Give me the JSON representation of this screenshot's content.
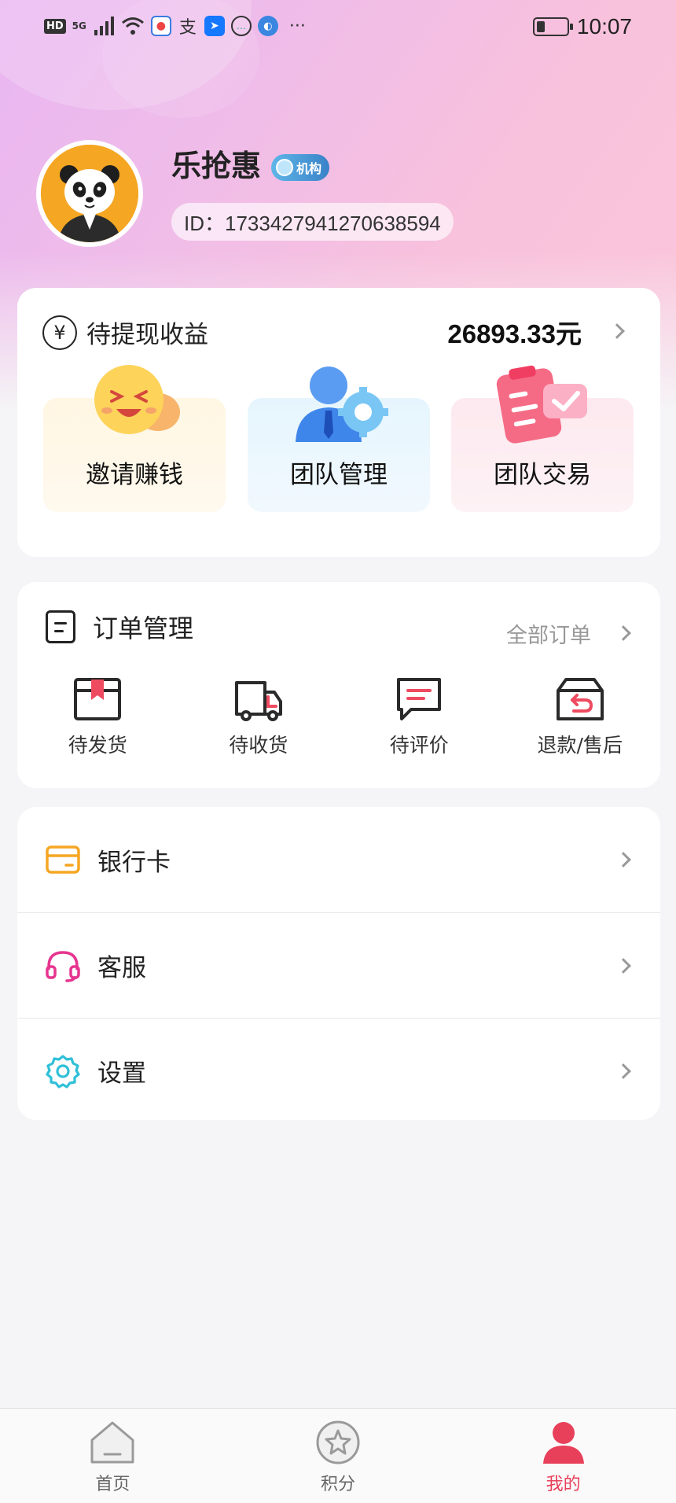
{
  "status_bar": {
    "hd": "HD",
    "network": "5G",
    "more": "···",
    "time": "10:07"
  },
  "profile": {
    "name": "乐抢惠",
    "badge": "机构",
    "id_text": "ID：1733427941270638594"
  },
  "earnings": {
    "currency_symbol": "¥",
    "title": "待提现收益",
    "amount": "26893.33元",
    "tiles": [
      {
        "label": "邀请赚钱",
        "icon": "emoji-laugh-icon"
      },
      {
        "label": "团队管理",
        "icon": "user-settings-icon"
      },
      {
        "label": "团队交易",
        "icon": "clipboard-check-icon"
      }
    ]
  },
  "orders": {
    "title": "订单管理",
    "all_link": "全部订单",
    "items": [
      {
        "label": "待发货",
        "icon": "package-icon"
      },
      {
        "label": "待收货",
        "icon": "truck-icon"
      },
      {
        "label": "待评价",
        "icon": "comment-icon"
      },
      {
        "label": "退款/售后",
        "icon": "return-box-icon"
      }
    ]
  },
  "menu": {
    "items": [
      {
        "label": "银行卡",
        "icon": "card-icon",
        "color": "#f5a623"
      },
      {
        "label": "客服",
        "icon": "headset-icon",
        "color": "#e6348f"
      },
      {
        "label": "设置",
        "icon": "gear-icon",
        "color": "#2fc0d8"
      }
    ]
  },
  "bottom_nav": {
    "items": [
      {
        "label": "首页",
        "icon": "home-icon"
      },
      {
        "label": "积分",
        "icon": "star-icon"
      },
      {
        "label": "我的",
        "icon": "user-icon",
        "active": true
      }
    ]
  },
  "colors": {
    "accent": "#e8405a",
    "header_gradient_start": "#e9b6f2",
    "header_gradient_end": "#fbc7dc"
  }
}
